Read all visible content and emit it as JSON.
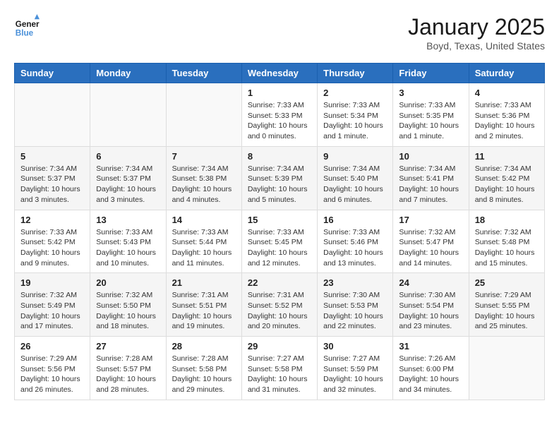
{
  "header": {
    "logo_line1": "General",
    "logo_line2": "Blue",
    "month_title": "January 2025",
    "location": "Boyd, Texas, United States"
  },
  "weekdays": [
    "Sunday",
    "Monday",
    "Tuesday",
    "Wednesday",
    "Thursday",
    "Friday",
    "Saturday"
  ],
  "weeks": [
    [
      {
        "day": "",
        "info": ""
      },
      {
        "day": "",
        "info": ""
      },
      {
        "day": "",
        "info": ""
      },
      {
        "day": "1",
        "info": "Sunrise: 7:33 AM\nSunset: 5:33 PM\nDaylight: 10 hours\nand 0 minutes."
      },
      {
        "day": "2",
        "info": "Sunrise: 7:33 AM\nSunset: 5:34 PM\nDaylight: 10 hours\nand 1 minute."
      },
      {
        "day": "3",
        "info": "Sunrise: 7:33 AM\nSunset: 5:35 PM\nDaylight: 10 hours\nand 1 minute."
      },
      {
        "day": "4",
        "info": "Sunrise: 7:33 AM\nSunset: 5:36 PM\nDaylight: 10 hours\nand 2 minutes."
      }
    ],
    [
      {
        "day": "5",
        "info": "Sunrise: 7:34 AM\nSunset: 5:37 PM\nDaylight: 10 hours\nand 3 minutes."
      },
      {
        "day": "6",
        "info": "Sunrise: 7:34 AM\nSunset: 5:37 PM\nDaylight: 10 hours\nand 3 minutes."
      },
      {
        "day": "7",
        "info": "Sunrise: 7:34 AM\nSunset: 5:38 PM\nDaylight: 10 hours\nand 4 minutes."
      },
      {
        "day": "8",
        "info": "Sunrise: 7:34 AM\nSunset: 5:39 PM\nDaylight: 10 hours\nand 5 minutes."
      },
      {
        "day": "9",
        "info": "Sunrise: 7:34 AM\nSunset: 5:40 PM\nDaylight: 10 hours\nand 6 minutes."
      },
      {
        "day": "10",
        "info": "Sunrise: 7:34 AM\nSunset: 5:41 PM\nDaylight: 10 hours\nand 7 minutes."
      },
      {
        "day": "11",
        "info": "Sunrise: 7:34 AM\nSunset: 5:42 PM\nDaylight: 10 hours\nand 8 minutes."
      }
    ],
    [
      {
        "day": "12",
        "info": "Sunrise: 7:33 AM\nSunset: 5:42 PM\nDaylight: 10 hours\nand 9 minutes."
      },
      {
        "day": "13",
        "info": "Sunrise: 7:33 AM\nSunset: 5:43 PM\nDaylight: 10 hours\nand 10 minutes."
      },
      {
        "day": "14",
        "info": "Sunrise: 7:33 AM\nSunset: 5:44 PM\nDaylight: 10 hours\nand 11 minutes."
      },
      {
        "day": "15",
        "info": "Sunrise: 7:33 AM\nSunset: 5:45 PM\nDaylight: 10 hours\nand 12 minutes."
      },
      {
        "day": "16",
        "info": "Sunrise: 7:33 AM\nSunset: 5:46 PM\nDaylight: 10 hours\nand 13 minutes."
      },
      {
        "day": "17",
        "info": "Sunrise: 7:32 AM\nSunset: 5:47 PM\nDaylight: 10 hours\nand 14 minutes."
      },
      {
        "day": "18",
        "info": "Sunrise: 7:32 AM\nSunset: 5:48 PM\nDaylight: 10 hours\nand 15 minutes."
      }
    ],
    [
      {
        "day": "19",
        "info": "Sunrise: 7:32 AM\nSunset: 5:49 PM\nDaylight: 10 hours\nand 17 minutes."
      },
      {
        "day": "20",
        "info": "Sunrise: 7:32 AM\nSunset: 5:50 PM\nDaylight: 10 hours\nand 18 minutes."
      },
      {
        "day": "21",
        "info": "Sunrise: 7:31 AM\nSunset: 5:51 PM\nDaylight: 10 hours\nand 19 minutes."
      },
      {
        "day": "22",
        "info": "Sunrise: 7:31 AM\nSunset: 5:52 PM\nDaylight: 10 hours\nand 20 minutes."
      },
      {
        "day": "23",
        "info": "Sunrise: 7:30 AM\nSunset: 5:53 PM\nDaylight: 10 hours\nand 22 minutes."
      },
      {
        "day": "24",
        "info": "Sunrise: 7:30 AM\nSunset: 5:54 PM\nDaylight: 10 hours\nand 23 minutes."
      },
      {
        "day": "25",
        "info": "Sunrise: 7:29 AM\nSunset: 5:55 PM\nDaylight: 10 hours\nand 25 minutes."
      }
    ],
    [
      {
        "day": "26",
        "info": "Sunrise: 7:29 AM\nSunset: 5:56 PM\nDaylight: 10 hours\nand 26 minutes."
      },
      {
        "day": "27",
        "info": "Sunrise: 7:28 AM\nSunset: 5:57 PM\nDaylight: 10 hours\nand 28 minutes."
      },
      {
        "day": "28",
        "info": "Sunrise: 7:28 AM\nSunset: 5:58 PM\nDaylight: 10 hours\nand 29 minutes."
      },
      {
        "day": "29",
        "info": "Sunrise: 7:27 AM\nSunset: 5:58 PM\nDaylight: 10 hours\nand 31 minutes."
      },
      {
        "day": "30",
        "info": "Sunrise: 7:27 AM\nSunset: 5:59 PM\nDaylight: 10 hours\nand 32 minutes."
      },
      {
        "day": "31",
        "info": "Sunrise: 7:26 AM\nSunset: 6:00 PM\nDaylight: 10 hours\nand 34 minutes."
      },
      {
        "day": "",
        "info": ""
      }
    ]
  ]
}
